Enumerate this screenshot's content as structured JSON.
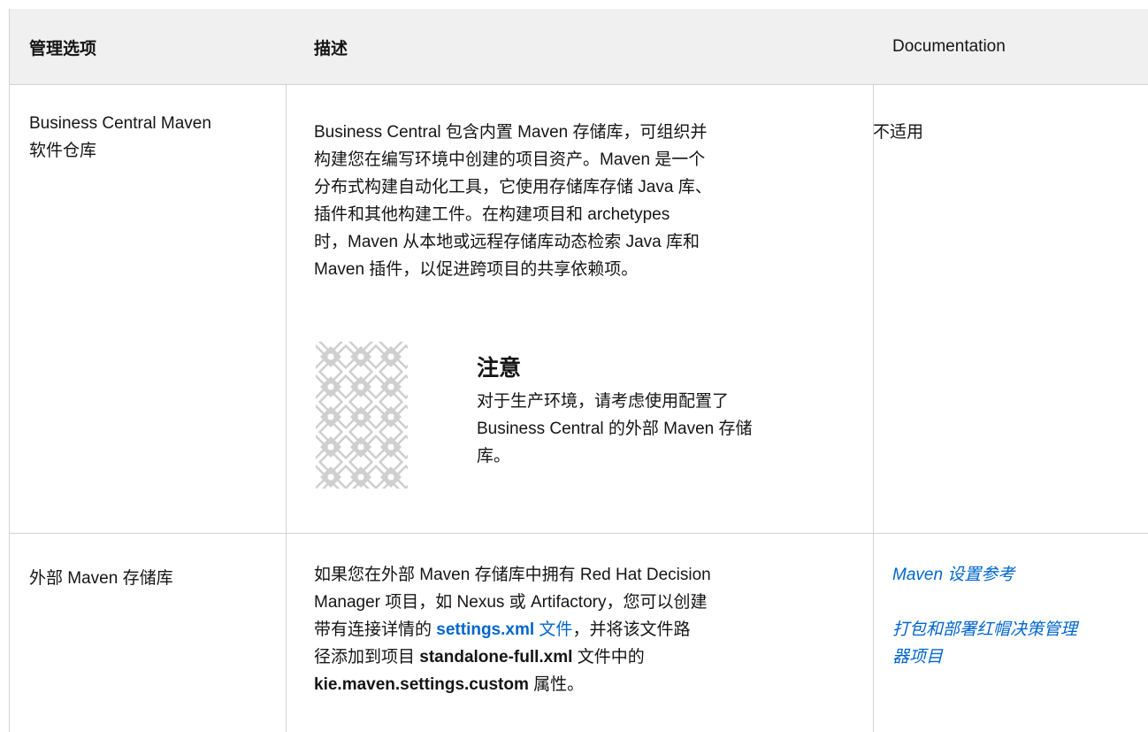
{
  "header": {
    "col1": "管理选项",
    "col2": "描述",
    "col3": "Documentation"
  },
  "row1": {
    "option_line1": "Business Central Maven",
    "option_line2": "软件仓库",
    "desc_lines": [
      "Business Central 包含内置 Maven 存储库，可组织并",
      "构建您在编写环境中创建的项目资产。Maven 是一个",
      "分布式构建自动化工具，它使用存储库存储 Java 库、",
      "插件和其他构建工件。在构建项目和 archetypes",
      "时，Maven 从本地或远程存储库动态检索 Java 库和",
      "Maven 插件，以促进跨项目的共享依赖项。"
    ],
    "note": {
      "title": "注意",
      "lines": [
        "对于生产环境，请考虑使用配置了",
        "Business Central 的外部 Maven 存储",
        "库。"
      ]
    },
    "doc": "不适用"
  },
  "row2": {
    "option": "外部 Maven 存储库",
    "desc_line1": "如果您在外部 Maven 存储库中拥有 Red Hat Decision",
    "desc_line2": "Manager 项目，如 Nexus 或 Artifactory，您可以创建",
    "desc_line3_a": "带有连接详情的 ",
    "desc_line3_link": "settings.xml",
    "desc_line3_b": " 文件",
    "desc_line3_c": "，并将该文件路",
    "desc_line4_a": "径添加到项目 ",
    "desc_line4_bold": "standalone-full.xml",
    "desc_line4_b": " 文件中的",
    "desc_line5_bold": "kie.maven.settings.custom",
    "desc_line5_b": " 属性。",
    "doc_link1": "Maven 设置参考",
    "doc_link2_line1": "打包和部署红帽决策管理",
    "doc_link2_line2": "器项目"
  },
  "colors": {
    "header_bg": "#f0f0f0",
    "border": "#d2d2d2",
    "link": "#0066cc",
    "text": "#151515"
  },
  "icons": {
    "note": "warning-pattern-icon"
  }
}
